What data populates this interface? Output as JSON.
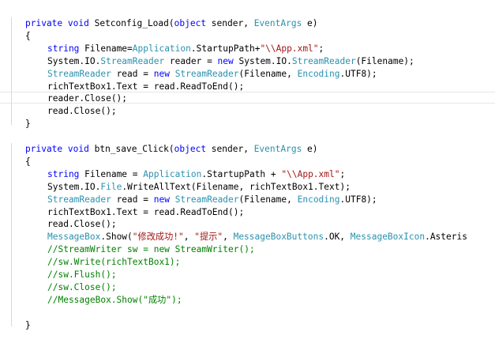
{
  "colors": {
    "keyword": "#0000ff",
    "type": "#2b91af",
    "string": "#a31515",
    "comment": "#008000",
    "text": "#000000"
  },
  "lines": [
    {
      "indent": 0,
      "tokens": [
        {
          "k": "kw",
          "t": "private"
        },
        {
          "k": "tx",
          "t": " "
        },
        {
          "k": "kw",
          "t": "void"
        },
        {
          "k": "tx",
          "t": " Setconfig_Load("
        },
        {
          "k": "kw",
          "t": "object"
        },
        {
          "k": "tx",
          "t": " sender, "
        },
        {
          "k": "ty",
          "t": "EventArgs"
        },
        {
          "k": "tx",
          "t": " e)"
        }
      ]
    },
    {
      "indent": 0,
      "tokens": [
        {
          "k": "tx",
          "t": "{"
        }
      ]
    },
    {
      "indent": 1,
      "tokens": [
        {
          "k": "kw",
          "t": "string"
        },
        {
          "k": "tx",
          "t": " Filename="
        },
        {
          "k": "ty",
          "t": "Application"
        },
        {
          "k": "tx",
          "t": ".StartupPath+"
        },
        {
          "k": "st",
          "t": "\"\\\\App.xml\""
        },
        {
          "k": "tx",
          "t": ";"
        }
      ]
    },
    {
      "indent": 1,
      "tokens": [
        {
          "k": "tx",
          "t": "System.IO."
        },
        {
          "k": "ty",
          "t": "StreamReader"
        },
        {
          "k": "tx",
          "t": " reader = "
        },
        {
          "k": "kw",
          "t": "new"
        },
        {
          "k": "tx",
          "t": " System.IO."
        },
        {
          "k": "ty",
          "t": "StreamReader"
        },
        {
          "k": "tx",
          "t": "(Filename);"
        }
      ]
    },
    {
      "indent": 1,
      "tokens": [
        {
          "k": "ty",
          "t": "StreamReader"
        },
        {
          "k": "tx",
          "t": " read = "
        },
        {
          "k": "kw",
          "t": "new"
        },
        {
          "k": "tx",
          "t": " "
        },
        {
          "k": "ty",
          "t": "StreamReader"
        },
        {
          "k": "tx",
          "t": "(Filename, "
        },
        {
          "k": "ty",
          "t": "Encoding"
        },
        {
          "k": "tx",
          "t": ".UTF8);"
        }
      ]
    },
    {
      "indent": 1,
      "tokens": [
        {
          "k": "tx",
          "t": "richTextBox1.Text = read.ReadToEnd();"
        }
      ]
    },
    {
      "indent": 1,
      "current": true,
      "tokens": [
        {
          "k": "tx",
          "t": "reader.Close();"
        }
      ]
    },
    {
      "indent": 1,
      "tokens": [
        {
          "k": "tx",
          "t": "read.Close();"
        }
      ]
    },
    {
      "indent": 0,
      "tokens": [
        {
          "k": "tx",
          "t": "}"
        }
      ]
    },
    {
      "indent": 0,
      "tokens": []
    },
    {
      "indent": 0,
      "tokens": [
        {
          "k": "kw",
          "t": "private"
        },
        {
          "k": "tx",
          "t": " "
        },
        {
          "k": "kw",
          "t": "void"
        },
        {
          "k": "tx",
          "t": " btn_save_Click("
        },
        {
          "k": "kw",
          "t": "object"
        },
        {
          "k": "tx",
          "t": " sender, "
        },
        {
          "k": "ty",
          "t": "EventArgs"
        },
        {
          "k": "tx",
          "t": " e)"
        }
      ]
    },
    {
      "indent": 0,
      "tokens": [
        {
          "k": "tx",
          "t": "{"
        }
      ]
    },
    {
      "indent": 1,
      "tokens": [
        {
          "k": "kw",
          "t": "string"
        },
        {
          "k": "tx",
          "t": " Filename = "
        },
        {
          "k": "ty",
          "t": "Application"
        },
        {
          "k": "tx",
          "t": ".StartupPath + "
        },
        {
          "k": "st",
          "t": "\"\\\\App.xml\""
        },
        {
          "k": "tx",
          "t": ";"
        }
      ]
    },
    {
      "indent": 1,
      "tokens": [
        {
          "k": "tx",
          "t": "System.IO."
        },
        {
          "k": "ty",
          "t": "File"
        },
        {
          "k": "tx",
          "t": ".WriteAllText(Filename, richTextBox1.Text);"
        }
      ]
    },
    {
      "indent": 1,
      "tokens": [
        {
          "k": "ty",
          "t": "StreamReader"
        },
        {
          "k": "tx",
          "t": " read = "
        },
        {
          "k": "kw",
          "t": "new"
        },
        {
          "k": "tx",
          "t": " "
        },
        {
          "k": "ty",
          "t": "StreamReader"
        },
        {
          "k": "tx",
          "t": "(Filename, "
        },
        {
          "k": "ty",
          "t": "Encoding"
        },
        {
          "k": "tx",
          "t": ".UTF8);"
        }
      ]
    },
    {
      "indent": 1,
      "tokens": [
        {
          "k": "tx",
          "t": "richTextBox1.Text = read.ReadToEnd();"
        }
      ]
    },
    {
      "indent": 1,
      "tokens": [
        {
          "k": "tx",
          "t": "read.Close();"
        }
      ]
    },
    {
      "indent": 1,
      "tokens": [
        {
          "k": "ty",
          "t": "MessageBox"
        },
        {
          "k": "tx",
          "t": ".Show("
        },
        {
          "k": "st",
          "t": "\"修改成功!\""
        },
        {
          "k": "tx",
          "t": ", "
        },
        {
          "k": "st",
          "t": "\"提示\""
        },
        {
          "k": "tx",
          "t": ", "
        },
        {
          "k": "ty",
          "t": "MessageBoxButtons"
        },
        {
          "k": "tx",
          "t": ".OK, "
        },
        {
          "k": "ty",
          "t": "MessageBoxIcon"
        },
        {
          "k": "tx",
          "t": ".Asteris"
        }
      ]
    },
    {
      "indent": 1,
      "tokens": [
        {
          "k": "cm",
          "t": "//StreamWriter sw = new StreamWriter();"
        }
      ]
    },
    {
      "indent": 1,
      "tokens": [
        {
          "k": "cm",
          "t": "//sw.Write(richTextBox1);"
        }
      ]
    },
    {
      "indent": 1,
      "tokens": [
        {
          "k": "cm",
          "t": "//sw.Flush();"
        }
      ]
    },
    {
      "indent": 1,
      "tokens": [
        {
          "k": "cm",
          "t": "//sw.Close();"
        }
      ]
    },
    {
      "indent": 1,
      "tokens": [
        {
          "k": "cm",
          "t": "//MessageBox.Show(\"成功\");"
        }
      ]
    },
    {
      "indent": 0,
      "tokens": []
    },
    {
      "indent": 0,
      "tokens": [
        {
          "k": "tx",
          "t": "}"
        }
      ]
    }
  ]
}
